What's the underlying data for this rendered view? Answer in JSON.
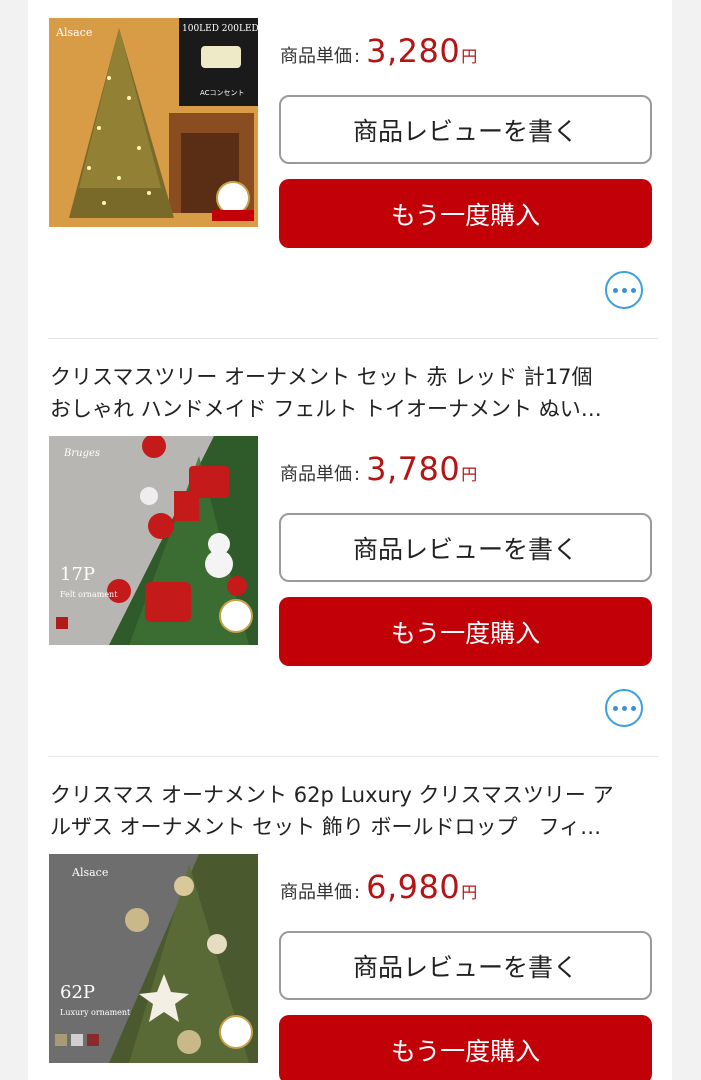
{
  "products": [
    {
      "title": "",
      "price_label": "商品単価",
      "price": "3,280",
      "yen": "円",
      "review_button": "商品レビューを書く",
      "rebuy_button": "もう一度購入",
      "image_labels": {
        "brand": "Alsace",
        "badge_top": "100LED 200LED",
        "badge_sub": "ACコンセント"
      }
    },
    {
      "title": "クリスマスツリー オーナメント セット 赤 レッド 計17個\nおしゃれ ハンドメイド フェルト トイオーナメント ぬい…",
      "price_label": "商品単価",
      "price": "3,780",
      "yen": "円",
      "review_button": "商品レビューを書く",
      "rebuy_button": "もう一度購入",
      "image_labels": {
        "brand": "Bruges",
        "count": "17P",
        "sub": "Felt ornament"
      }
    },
    {
      "title": "クリスマス オーナメント 62p Luxury クリスマスツリー ア\nルザス オーナメント セット 飾り ボールドロップ　フィ…",
      "price_label": "商品単価",
      "price": "6,980",
      "yen": "円",
      "review_button": "商品レビューを書く",
      "rebuy_button": "もう一度購入",
      "image_labels": {
        "brand": "Alsace",
        "count": "62P",
        "sub": "Luxury ornament"
      }
    }
  ],
  "colors": {
    "accent": "#c20008",
    "price": "#b51414",
    "more_icon": "#3aa0e0"
  },
  "icons": {
    "more": "more-options-icon"
  }
}
